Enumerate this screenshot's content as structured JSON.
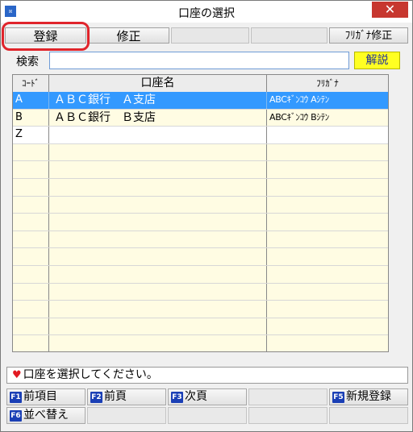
{
  "window": {
    "icon_text": "☒",
    "title": "口座の選択",
    "close_symbol": "✕"
  },
  "toolbar": {
    "register_label": "登録",
    "edit_label": "修正",
    "furigana_edit_label": "ﾌﾘｶﾞﾅ修正"
  },
  "search": {
    "label": "検索",
    "value": "",
    "explain_label": "解説"
  },
  "table": {
    "headers": [
      "ｺｰﾄﾞ",
      "口座名",
      "ﾌﾘｶﾞﾅ"
    ],
    "rows": [
      {
        "code": "A",
        "name": "ＡＢＣ銀行　Ａ支店",
        "kana": "ABCｷﾞﾝｺｳ Aｼﾃﾝ",
        "selected": true
      },
      {
        "code": "B",
        "name": "ＡＢＣ銀行　Ｂ支店",
        "kana": "ABCｷﾞﾝｺｳ Bｼﾃﾝ",
        "selected": false
      },
      {
        "code": "Z",
        "name": "",
        "kana": "",
        "selected": false
      },
      {
        "code": "",
        "name": "",
        "kana": ""
      },
      {
        "code": "",
        "name": "",
        "kana": ""
      },
      {
        "code": "",
        "name": "",
        "kana": ""
      },
      {
        "code": "",
        "name": "",
        "kana": ""
      },
      {
        "code": "",
        "name": "",
        "kana": ""
      },
      {
        "code": "",
        "name": "",
        "kana": ""
      },
      {
        "code": "",
        "name": "",
        "kana": ""
      },
      {
        "code": "",
        "name": "",
        "kana": ""
      },
      {
        "code": "",
        "name": "",
        "kana": ""
      },
      {
        "code": "",
        "name": "",
        "kana": ""
      },
      {
        "code": "",
        "name": "",
        "kana": ""
      },
      {
        "code": "",
        "name": "",
        "kana": ""
      }
    ]
  },
  "status": {
    "icon": "heart-icon",
    "message": "口座を選択してください。"
  },
  "function_keys": {
    "f1": {
      "key": "F1",
      "label": "前項目"
    },
    "f2": {
      "key": "F2",
      "label": "前頁"
    },
    "f3": {
      "key": "F3",
      "label": "次頁"
    },
    "f5": {
      "key": "F5",
      "label": "新規登録"
    },
    "f6": {
      "key": "F6",
      "label": "並べ替え"
    }
  },
  "colors": {
    "selected_row": "#3399ff",
    "alt_row": "#fffce3",
    "highlight": "#e0242b",
    "explain_button": "#ffff22",
    "fkey_badge": "#1a3fb5"
  }
}
